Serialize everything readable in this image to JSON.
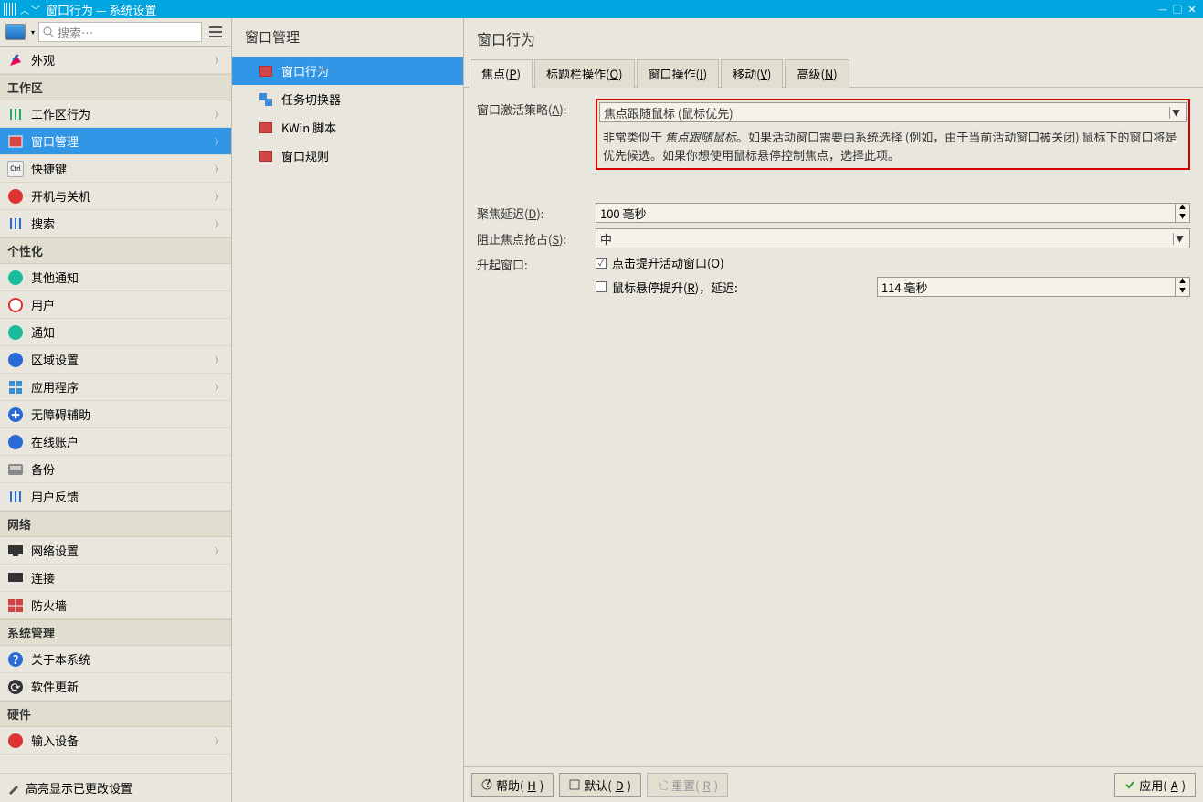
{
  "window": {
    "title": "窗口行为 — 系统设置"
  },
  "search": {
    "placeholder": "搜索…"
  },
  "nav": {
    "appearance": {
      "label": "外观"
    },
    "workspace_hdr": "工作区",
    "workspace": {
      "behavior": "工作区行为",
      "windowmgmt": "窗口管理",
      "shortcuts": "快捷键",
      "startup": "开机与关机",
      "search": "搜索"
    },
    "personal_hdr": "个性化",
    "personal": {
      "othernotif": "其他通知",
      "user": "用户",
      "notif": "通知",
      "region": "区域设置",
      "apps": "应用程序",
      "a11y": "无障碍辅助",
      "online": "在线账户",
      "backup": "备份",
      "feedback": "用户反馈"
    },
    "network_hdr": "网络",
    "network": {
      "settings": "网络设置",
      "conn": "连接",
      "firewall": "防火墙"
    },
    "sysadmin_hdr": "系统管理",
    "sysadmin": {
      "about": "关于本系统",
      "update": "软件更新"
    },
    "hardware_hdr": "硬件",
    "hardware": {
      "input": "输入设备"
    },
    "highlight": "高亮显示已更改设置"
  },
  "mid": {
    "title": "窗口管理",
    "items": {
      "behavior": "窗口行为",
      "switcher": "任务切换器",
      "kwin": "KWin 脚本",
      "rules": "窗口规则"
    }
  },
  "right": {
    "title": "窗口行为",
    "tabs": {
      "focus": "焦点(",
      "focusK": "P",
      "focusE": ")",
      "titlebar": "标题栏操作(",
      "titlebarK": "O",
      "titlebarE": ")",
      "winact": "窗口操作(",
      "winactK": "I",
      "winactE": ")",
      "move": "移动(",
      "moveK": "V",
      "moveE": ")",
      "adv": "高级(",
      "advK": "N",
      "advE": ")"
    },
    "form": {
      "policy_lbl": "窗口激活策略(",
      "policy_k": "A",
      "policy_e": "):",
      "policy_val": "焦点跟随鼠标 (鼠标优先)",
      "help1": "非常类似于 ",
      "help_i": "焦点跟随鼠标",
      "help2": "。如果活动窗口需要由系统选择 (例如，由于当前活动窗口被关闭) 鼠标下的窗口将是优先候选。如果你想使用鼠标悬停控制焦点，选择此项。",
      "delay_lbl": "聚焦延迟(",
      "delay_k": "D",
      "delay_e": "):",
      "delay_val": "100 毫秒",
      "steal_lbl": "阻止焦点抢占(",
      "steal_k": "S",
      "steal_e": "):",
      "steal_val": "中",
      "raise_lbl": "升起窗口:",
      "raise_click": "点击提升活动窗口(",
      "raise_click_k": "O",
      "raise_click_e": ")",
      "raise_hover": "鼠标悬停提升(",
      "raise_hover_k": "R",
      "raise_hover_e": ")，延迟:",
      "hover_val": "114 毫秒"
    },
    "buttons": {
      "help": "帮助(",
      "help_k": "H",
      "help_e": ")",
      "defaults": "默认(",
      "defaults_k": "D",
      "defaults_e": ")",
      "reset": "重置(",
      "reset_k": "R",
      "reset_e": ")",
      "apply": "应用(",
      "apply_k": "A",
      "apply_e": ")"
    }
  }
}
